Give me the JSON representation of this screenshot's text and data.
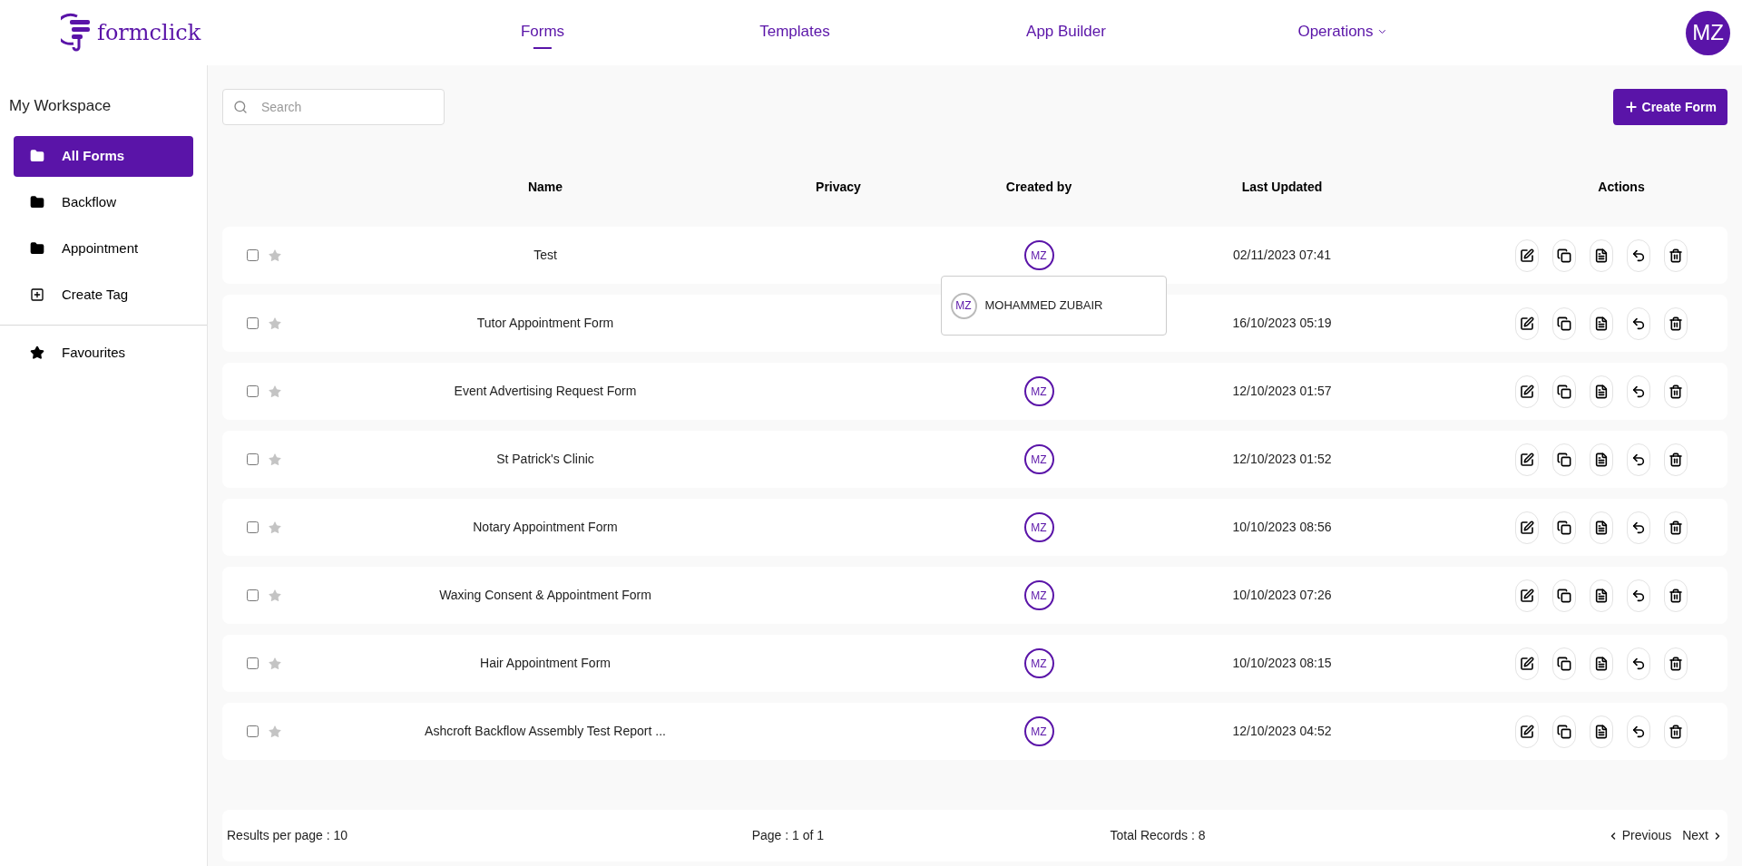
{
  "brand": {
    "name": "formclick"
  },
  "nav": [
    {
      "label": "Forms",
      "selected": true,
      "dropdown": false
    },
    {
      "label": "Templates",
      "selected": false,
      "dropdown": false
    },
    {
      "label": "App Builder",
      "selected": false,
      "dropdown": false
    },
    {
      "label": "Operations",
      "selected": false,
      "dropdown": true
    }
  ],
  "user_avatar": "MZ",
  "sidebar": {
    "title": "My Workspace",
    "items": [
      {
        "label": "All Forms",
        "kind": "folder",
        "selected": true
      },
      {
        "label": "Backflow",
        "kind": "folder",
        "selected": false
      },
      {
        "label": "Appointment",
        "kind": "folder",
        "selected": false
      },
      {
        "label": "Create Tag",
        "kind": "add",
        "selected": false
      },
      {
        "label": "Favourites",
        "kind": "star",
        "selected": false
      }
    ]
  },
  "search": {
    "placeholder": "Search"
  },
  "create_button": "Create Form",
  "table": {
    "columns": [
      "Name",
      "Privacy",
      "Created by",
      "Last Updated",
      "Actions"
    ],
    "rows": [
      {
        "name": "Test",
        "creator": "MZ",
        "updated": "02/11/2023 07:41",
        "checked": false,
        "favourite": false
      },
      {
        "name": "Tutor Appointment Form",
        "updated": "16/10/2023 05:19",
        "checked": false,
        "favourite": false
      },
      {
        "name": "Event Advertising Request Form",
        "creator": "MZ",
        "updated": "12/10/2023 01:57",
        "checked": false,
        "favourite": false
      },
      {
        "name": "St Patrick's Clinic",
        "creator": "MZ",
        "updated": "12/10/2023 01:52",
        "checked": false,
        "favourite": false
      },
      {
        "name": "Notary Appointment Form",
        "creator": "MZ",
        "updated": "10/10/2023 08:56",
        "checked": false,
        "favourite": false
      },
      {
        "name": "Waxing Consent & Appointment Form",
        "creator": "MZ",
        "updated": "10/10/2023 07:26",
        "checked": false,
        "favourite": false
      },
      {
        "name": "Hair Appointment Form",
        "creator": "MZ",
        "updated": "10/10/2023 08:15",
        "checked": false,
        "favourite": false
      },
      {
        "name": "Ashcroft Backflow Assembly Test Report ...",
        "creator": "MZ",
        "updated": "12/10/2023 04:52",
        "checked": false,
        "favourite": false
      }
    ]
  },
  "tooltip": {
    "initials": "MZ",
    "name": "MOHAMMED ZUBAIR"
  },
  "footer": {
    "results_per_page": "Results per page : 10",
    "page": "Page : 1 of 1",
    "total": "Total Records : 8",
    "previous": "Previous",
    "next": "Next"
  }
}
